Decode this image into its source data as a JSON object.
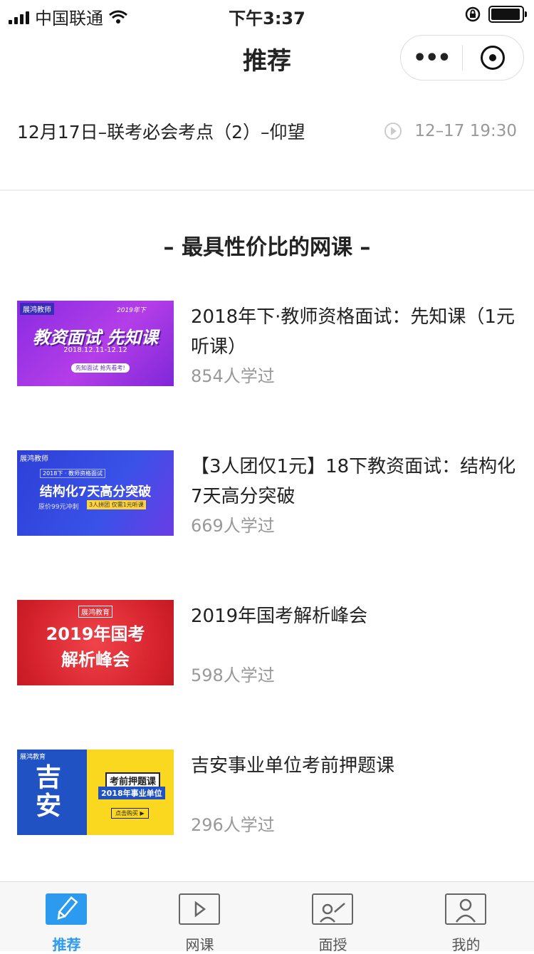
{
  "status": {
    "carrier": "中国联通",
    "time": "下午3:37",
    "battery": 0.95
  },
  "navbar": {
    "title": "推荐"
  },
  "live": {
    "title": "12月17日–联考必会考点（2）–仰望",
    "time": "12–17 19:30"
  },
  "section": {
    "title": "– 最具性价比的网课 –"
  },
  "courses": [
    {
      "title": "2018年下·教师资格面试：先知课（1元听课）",
      "count": "854人学过",
      "thumb": {
        "logo": "展鸿教师",
        "text": "教资面试 先知课",
        "date": "2018.12.11-12.12",
        "tag": "2019年下",
        "btn": "先知面试 抢先看考!"
      }
    },
    {
      "title": "【3人团仅1元】18下教资面试：结构化7天高分突破",
      "count": "669人学过",
      "thumb": {
        "logo": "展鸿教师",
        "tag": "2018下 · 教师资格面试",
        "text": "结构化7天高分突破",
        "price": "原价99元冲刺",
        "deal": "3人拼团 仅需1元听课"
      }
    },
    {
      "title": "2019年国考解析峰会",
      "count": "598人学过",
      "thumb": {
        "logo": "展鸿教育",
        "line1": "2019年国考",
        "line2": "解析峰会"
      }
    },
    {
      "title": "吉安事业单位考前押题课",
      "count": "296人学过",
      "thumb": {
        "logo": "展鸿教育",
        "big": "吉安",
        "label": "考前押题课",
        "sub": "2018年事业单位",
        "btn": "点击购买 ▶"
      }
    }
  ],
  "tabs": [
    {
      "label": "推荐",
      "icon": "pencil-icon",
      "active": true
    },
    {
      "label": "网课",
      "icon": "play-icon"
    },
    {
      "label": "面授",
      "icon": "teaching-icon"
    },
    {
      "label": "我的",
      "icon": "user-icon"
    }
  ],
  "colors": {
    "accent": "#2b9aef",
    "muted": "#999999"
  }
}
